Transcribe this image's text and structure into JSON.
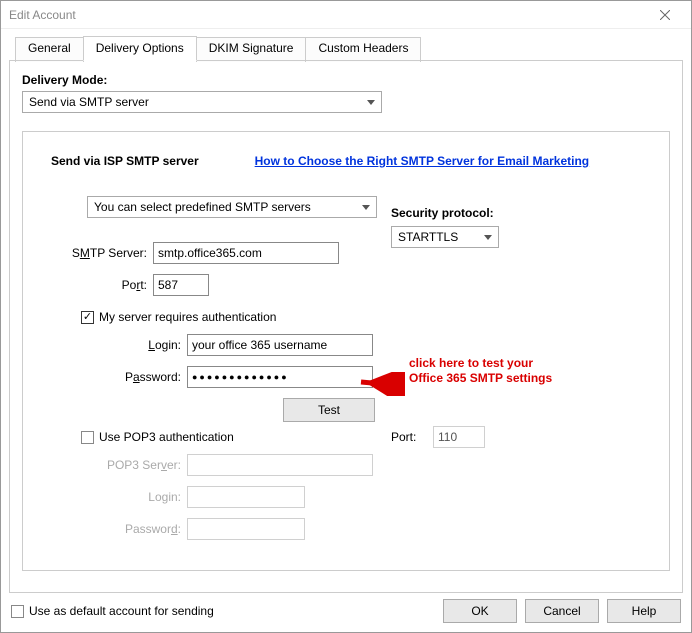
{
  "window": {
    "title": "Edit Account"
  },
  "tabs": {
    "general": "General",
    "delivery": "Delivery Options",
    "dkim": "DKIM Signature",
    "custom": "Custom Headers"
  },
  "delivery_mode": {
    "label": "Delivery Mode:",
    "value": "Send via SMTP server"
  },
  "section": {
    "heading": "Send via ISP SMTP server",
    "help_link": "How to Choose the Right SMTP Server for Email Marketing",
    "predefined": "You can select predefined SMTP servers"
  },
  "smtp": {
    "server_label_pre": "S",
    "server_label_u": "M",
    "server_label_post": "TP Server:",
    "server_value": "smtp.office365.com",
    "port_label_pre": "Po",
    "port_label_u": "r",
    "port_label_post": "t:",
    "port_value": "587"
  },
  "security": {
    "label": "Security protocol:",
    "value": "STARTTLS"
  },
  "auth": {
    "checkbox_label": "My server requires authentication",
    "login_label_u": "L",
    "login_label_post": "ogin:",
    "login_value": "your office 365 username",
    "password_label_pre": "P",
    "password_label_u": "a",
    "password_label_post": "ssword:",
    "password_value": "●●●●●●●●●●●●●"
  },
  "test_button": "Test",
  "pop3": {
    "checkbox_label": "Use POP3 authentication",
    "server_label_pre": "POP3 Ser",
    "server_label_u": "v",
    "server_label_post": "er:",
    "login_label_pre": "Lo",
    "login_label_u": "g",
    "login_label_post": "in:",
    "password_label_pre": "Passwor",
    "password_label_u": "d",
    "password_label_post": ":",
    "port_label": "Port:",
    "port_value": "110"
  },
  "annotation": {
    "line1": "click here to test your",
    "line2": "Office 365 SMTP settings"
  },
  "footer": {
    "default_label": "Use as default account for sending",
    "ok": "OK",
    "cancel": "Cancel",
    "help": "Help"
  }
}
